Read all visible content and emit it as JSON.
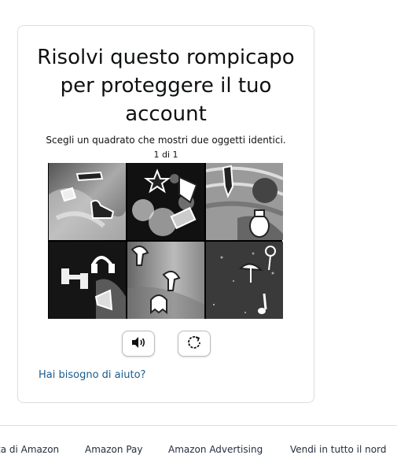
{
  "puzzle": {
    "title": "Risolvi questo rompicapo per proteggere il tuo account",
    "instruction": "Scegli un quadrato che mostri due oggetti identici.",
    "counter": "1 di 1",
    "tiles": [
      {
        "index": 1,
        "objects": [
          "hat",
          "sneaker",
          "shoe"
        ]
      },
      {
        "index": 2,
        "objects": [
          "starfish",
          "flag",
          "domino"
        ]
      },
      {
        "index": 3,
        "objects": [
          "pen",
          "grenade"
        ]
      },
      {
        "index": 4,
        "objects": [
          "headphones",
          "dumbbell",
          "horn"
        ]
      },
      {
        "index": 5,
        "objects": [
          "mushroom",
          "mushroom",
          "ghost"
        ]
      },
      {
        "index": 6,
        "objects": [
          "flower",
          "umbrella",
          "music-note"
        ]
      }
    ]
  },
  "buttons": {
    "audio_icon": "speaker-icon",
    "reload_icon": "reload-icon"
  },
  "help": {
    "label": "Hai bisogno di aiuto?"
  },
  "footer": {
    "links": [
      "ta di Amazon",
      "Amazon Pay",
      "Amazon Advertising",
      "Vendi in tutto il nord"
    ]
  }
}
